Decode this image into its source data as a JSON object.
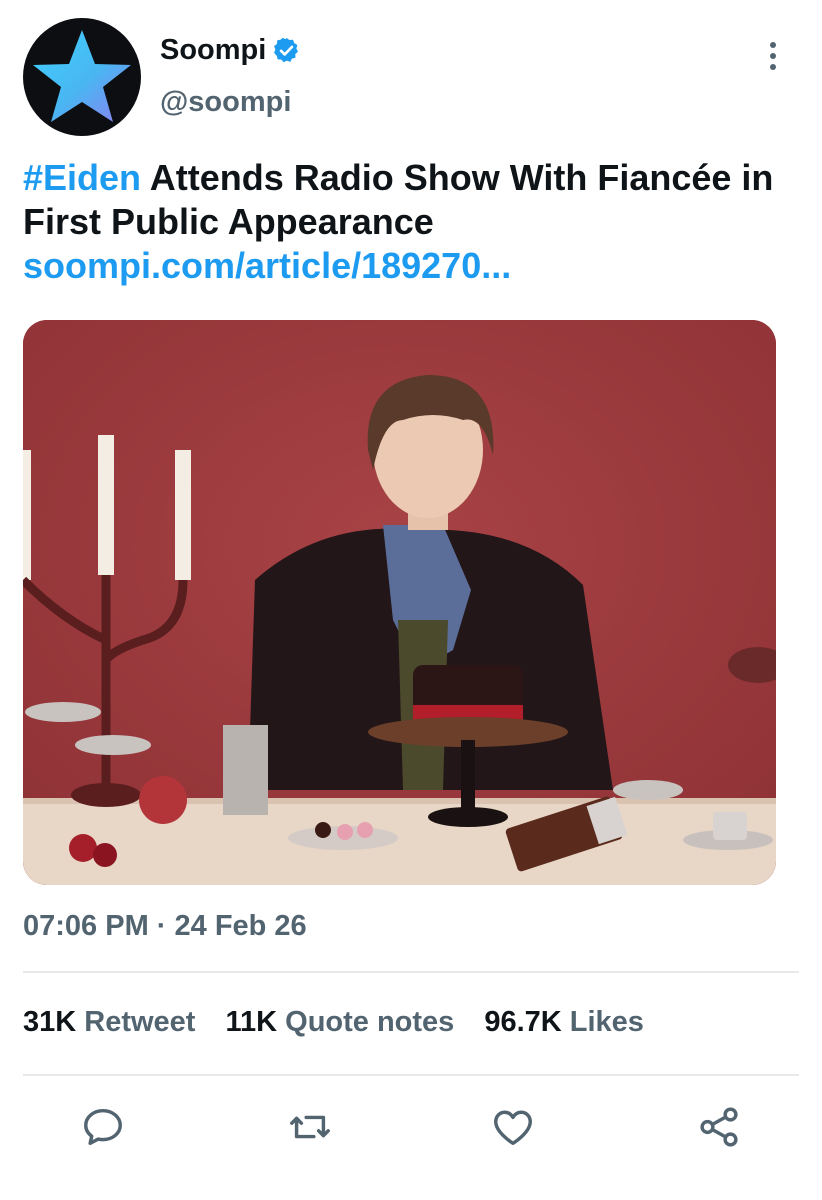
{
  "account": {
    "name": "Soompi",
    "handle": "@soompi",
    "verified_icon": "verified-badge-icon"
  },
  "tweet": {
    "hashtag": "#Eiden",
    "text": " Attends Radio Show With Fiancée in First Public Appearance",
    "link": "soompi.com/article/189270...",
    "timestamp": "07:06 PM · 24 Feb 26"
  },
  "stats": {
    "retweets_count": "31K",
    "retweets_label": "Retweet",
    "quotes_count": "11K",
    "quotes_label": "Quote notes",
    "likes_count": "96.7K",
    "likes_label": "Likes"
  },
  "colors": {
    "accent": "#1d9bf0",
    "muted": "#536471",
    "photo_background": "#9d3b3e"
  },
  "icons": [
    "star-logo-icon",
    "verified-badge-icon",
    "more-options-icon",
    "reply-icon",
    "retweet-icon",
    "like-icon",
    "share-icon"
  ]
}
